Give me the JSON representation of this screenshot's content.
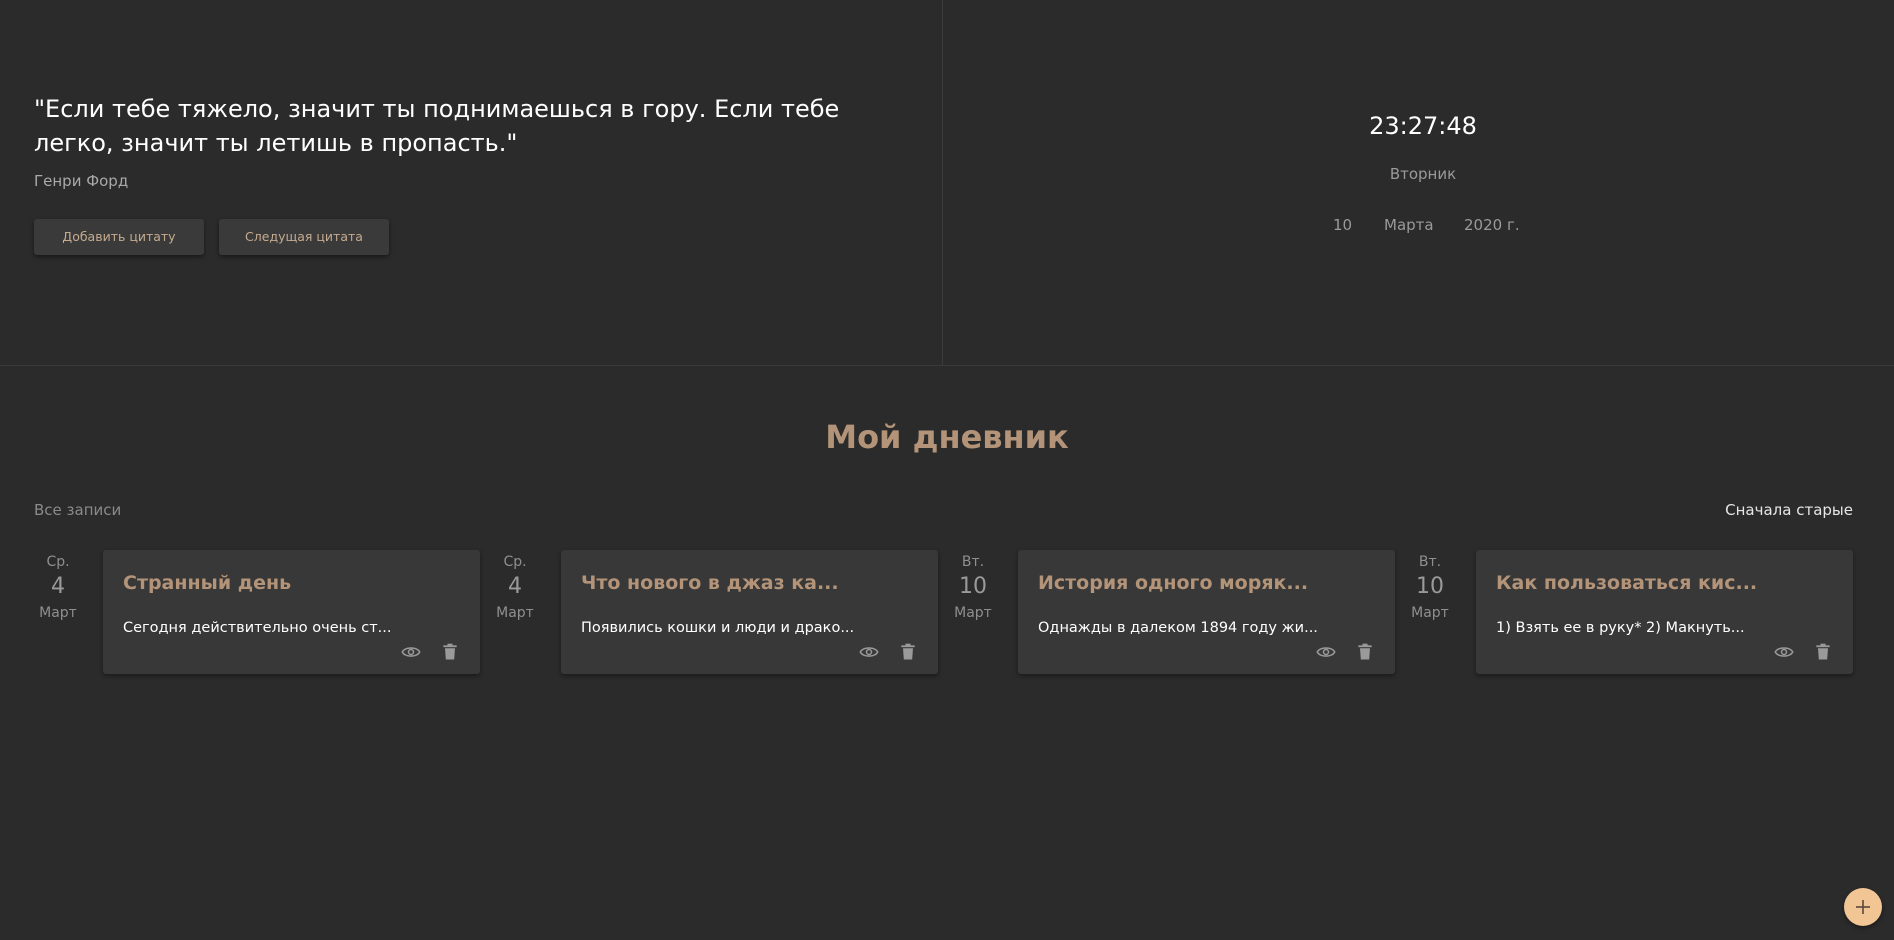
{
  "quote": {
    "text": "\"Если тебе тяжело, значит ты поднимаешься в гору. Если тебе легко, значит ты летишь в пропасть.\"",
    "author": "Генри Форд",
    "add_label": "Добавить цитату",
    "next_label": "Следущая цитата"
  },
  "clock": {
    "time": "23:27:48",
    "weekday": "Вторник",
    "day": "10",
    "month": "Марта",
    "year": "2020 г."
  },
  "diary": {
    "title": "Мой дневник",
    "all_label": "Все записи",
    "sort_label": "Сначала старые",
    "entries": [
      {
        "weekday": "Ср.",
        "day": "4",
        "month": "Март",
        "title": "Странный день",
        "text": "Сегодня действительно очень ст..."
      },
      {
        "weekday": "Ср.",
        "day": "4",
        "month": "Март",
        "title": "Что нового в джаз ка...",
        "text": "Появились кошки и люди и драко..."
      },
      {
        "weekday": "Вт.",
        "day": "10",
        "month": "Март",
        "title": "История одного моряк...",
        "text": "Однажды в далеком 1894 году жи..."
      },
      {
        "weekday": "Вт.",
        "day": "10",
        "month": "Март",
        "title": "Как пользоваться кис...",
        "text": "1) Взять ее в руку* 2) Макнуть..."
      }
    ]
  },
  "colors": {
    "background": "#2b2b2b",
    "accent": "#b39479",
    "fab": "#f2c594",
    "card": "#383838"
  },
  "icons": {
    "view": "eye-icon",
    "delete": "trash-icon",
    "add": "plus-icon"
  }
}
